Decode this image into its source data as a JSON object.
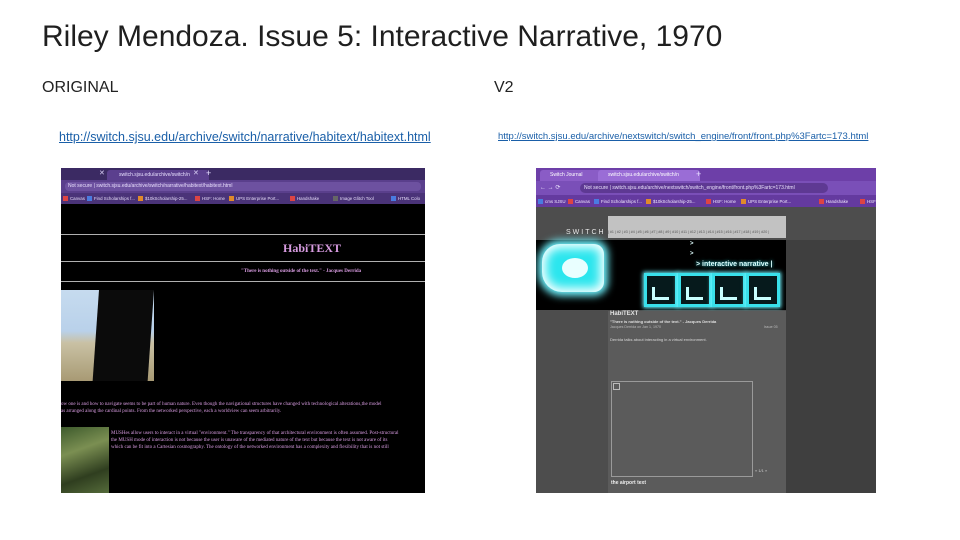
{
  "slide": {
    "title": "Riley Mendoza.  Issue 5: Interactive Narrative, 1970",
    "original_label": "ORIGINAL",
    "v2_label": "V2",
    "original_url": "http://switch.sjsu.edu/archive/switch/narrative/habitext/habitext.html",
    "v2_url": "http://switch.sjsu.edu/archive/nextswitch/switch_engine/front/front.php%3Fartc=173.html"
  },
  "original_shot": {
    "tab_title": "switch.sjsu.edu/archive/switch/n",
    "address": "Not secure  |  switch.sjsu.edu/archive/switch/narrative/habitext/habitext.html",
    "bookmarks": [
      "Canvas",
      "Find Scholarships f...",
      "$10kScholarship-25...",
      "HSF: Home",
      "UPS Enterprise Port...",
      "Handshake",
      "Image Glitch Tool",
      "HTML Colo"
    ],
    "page_title": "HabiTEXT",
    "quote": "\"There is nothing outside of the text.\" - Jacques Derrida",
    "para1_lines": [
      "ow one is and how to navigate seems to be part of human nature. Even though the navigational structures have changed with technological alterations,the model",
      "as arranged along the cardinal points. From the networked perspective, each a worldview can seem arbitrarily."
    ],
    "para2_lines": [
      "MUSHes allow users to interact in a virtual \"environment.\" The transparency of that architectural environment is often assumed. Post-structural",
      "the MUSH mode of interaction is not because the user is unaware of the mediated nature of the text but because the text is not aware of its",
      "which can be fit into a Cartesian cosmography. The ontology of the networked environment has a complexity and flexibility that is not still"
    ]
  },
  "v2_shot": {
    "tab1": "Switch Journal",
    "tab2": "switch.sjsu.edu/archive/switch/n",
    "address": "Not secure  |  switch.sjsu.edu/archive/nextswitch/switch_engine/front/front.php%3Fartc=173.html",
    "bookmarks": [
      "cms SJSU",
      "Canvas",
      "Find Scholarships f...",
      "$10kScholarship-25...",
      "HSF: Home",
      "UPS Enterprise Port...",
      "Handshake",
      "HSF"
    ],
    "logo": "SWITCH",
    "menu": "| #1 | #2 | #3 | #4 | #5 | #6 | #7 | #8 | #9 | #10 | #11 | #12 | #13 | #14 | #15 | #16 | #17 | #18 | #19 | #20 |",
    "headline": "> interactive narrative |",
    "article_title": "HabiTEXT",
    "article_quote": "\"There is nothing outside of the text.\" - Jacques Derrida",
    "article_meta": "Jacques Derrida on Jan 1, 1970",
    "article_meta_right": "Issue 05",
    "article_body": "Derrida talks about interacting in a virtual environment.",
    "image_nav": "« 1/1 »",
    "caption": "the airport text"
  }
}
